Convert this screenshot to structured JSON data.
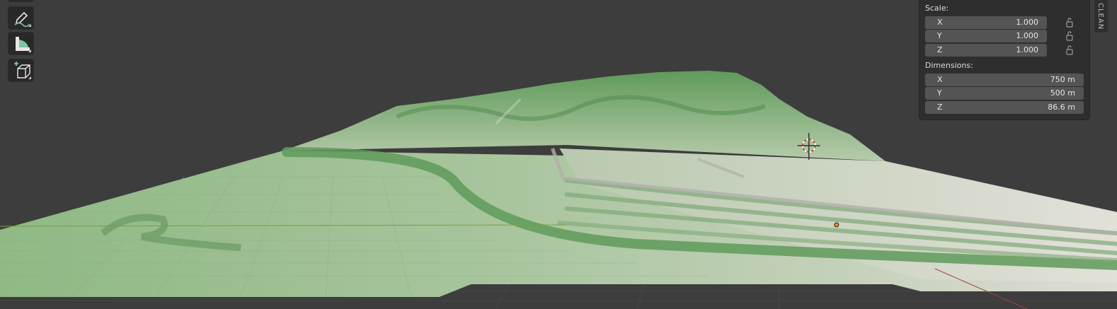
{
  "viewport": {
    "colors": {
      "background": "#3d3d3d",
      "grid": "#4a4a4a",
      "terrain_green": "#6f9e67",
      "terrain_light": "#c9d2bf",
      "x_axis": "#a34040",
      "y_axis": "#7aa03a"
    }
  },
  "toolbar": {
    "tools": [
      {
        "icon": "annotate-icon",
        "name": "Annotate"
      },
      {
        "icon": "measure-icon",
        "name": "Measure"
      },
      {
        "icon": "add-cube-icon",
        "name": "Add Cube"
      }
    ]
  },
  "transform_panel": {
    "scale_label": "Scale:",
    "scale": [
      {
        "axis": "X",
        "value": "1.000"
      },
      {
        "axis": "Y",
        "value": "1.000"
      },
      {
        "axis": "Z",
        "value": "1.000"
      }
    ],
    "dimensions_label": "Dimensions:",
    "dimensions": [
      {
        "axis": "X",
        "value": "750 m"
      },
      {
        "axis": "Y",
        "value": "500 m"
      },
      {
        "axis": "Z",
        "value": "86.6 m"
      }
    ]
  },
  "side_tab": {
    "label": "CLEAN"
  }
}
